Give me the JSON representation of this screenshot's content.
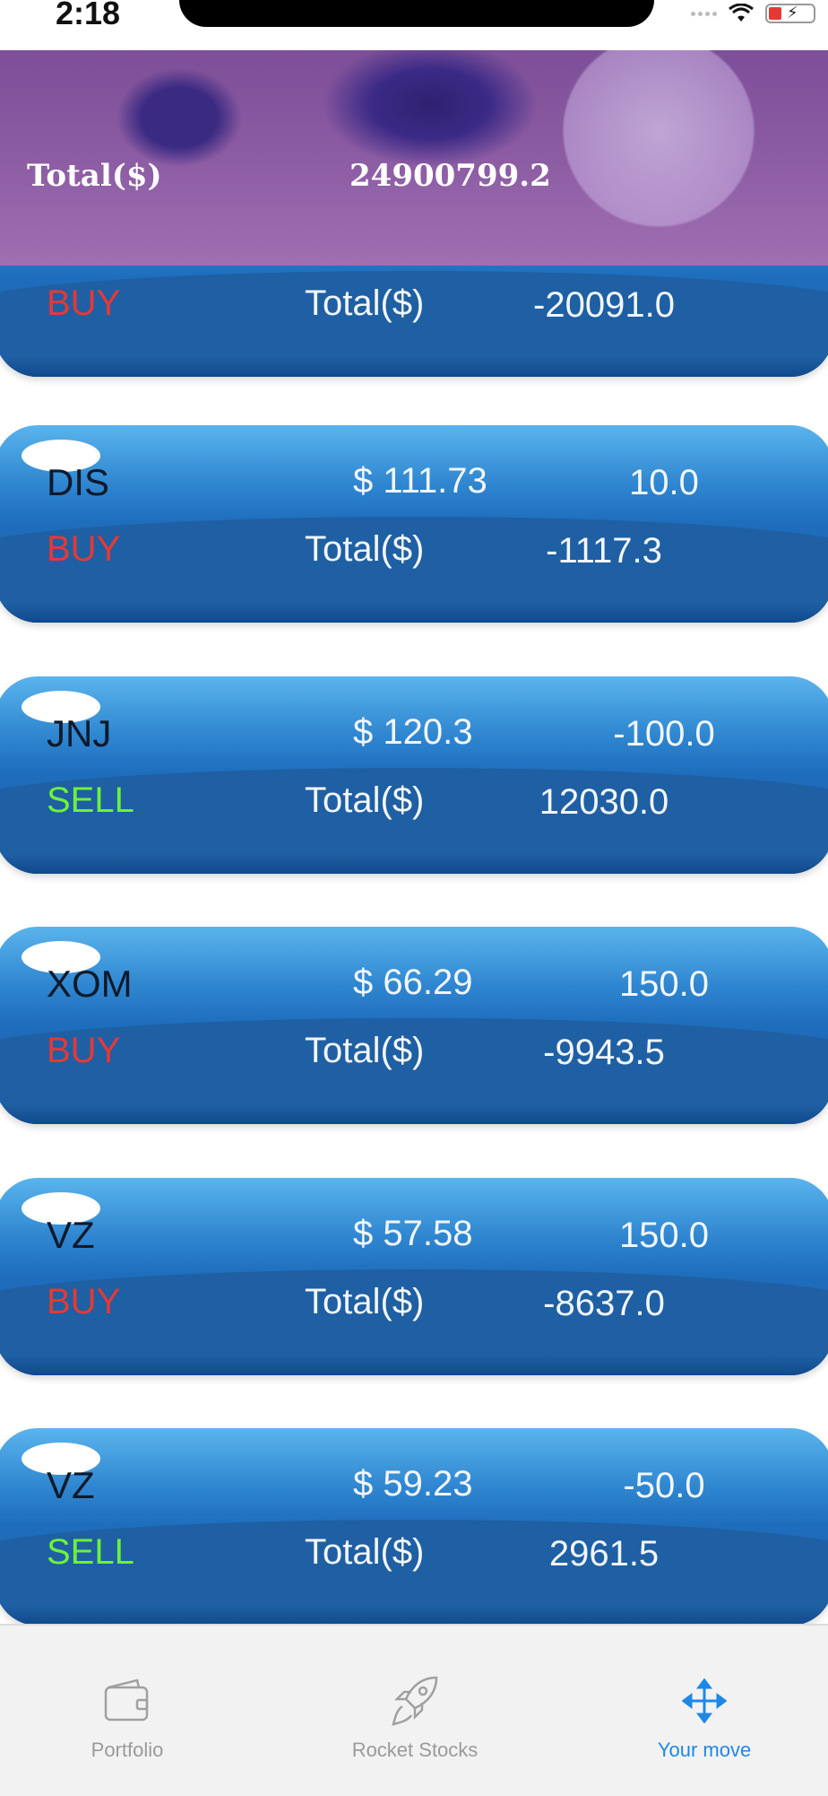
{
  "status_bar": {
    "time": "2:18"
  },
  "header": {
    "label": "Total($)",
    "value": "24900799.2"
  },
  "partial_card": {
    "action": "BUY",
    "action_type": "buy",
    "total_label": "Total($)",
    "total_value": "-20091.0"
  },
  "cards": [
    {
      "symbol": "DIS",
      "price": "$  111.73",
      "qty": "10.0",
      "action": "BUY",
      "action_type": "buy",
      "total_label": "Total($)",
      "total_value": "-1117.3"
    },
    {
      "symbol": "JNJ",
      "price": "$  120.3",
      "qty": "-100.0",
      "action": "SELL",
      "action_type": "sell",
      "total_label": "Total($)",
      "total_value": "12030.0"
    },
    {
      "symbol": "XOM",
      "price": "$  66.29",
      "qty": "150.0",
      "action": "BUY",
      "action_type": "buy",
      "total_label": "Total($)",
      "total_value": "-9943.5"
    },
    {
      "symbol": "VZ",
      "price": "$  57.58",
      "qty": "150.0",
      "action": "BUY",
      "action_type": "buy",
      "total_label": "Total($)",
      "total_value": "-8637.0"
    },
    {
      "symbol": "VZ",
      "price": "$  59.23",
      "qty": "-50.0",
      "action": "SELL",
      "action_type": "sell",
      "total_label": "Total($)",
      "total_value": "2961.5"
    }
  ],
  "tab_bar": {
    "items": [
      {
        "label": "Portfolio",
        "icon": "wallet-icon",
        "active": false
      },
      {
        "label": "Rocket Stocks",
        "icon": "rocket-icon",
        "active": false
      },
      {
        "label": "Your move",
        "icon": "move-arrows-icon",
        "active": true
      }
    ]
  },
  "colors": {
    "buy": "#e53935",
    "sell": "#6cf23a",
    "active_tab": "#1e88e5",
    "inactive_tab": "#9a9a9a"
  }
}
